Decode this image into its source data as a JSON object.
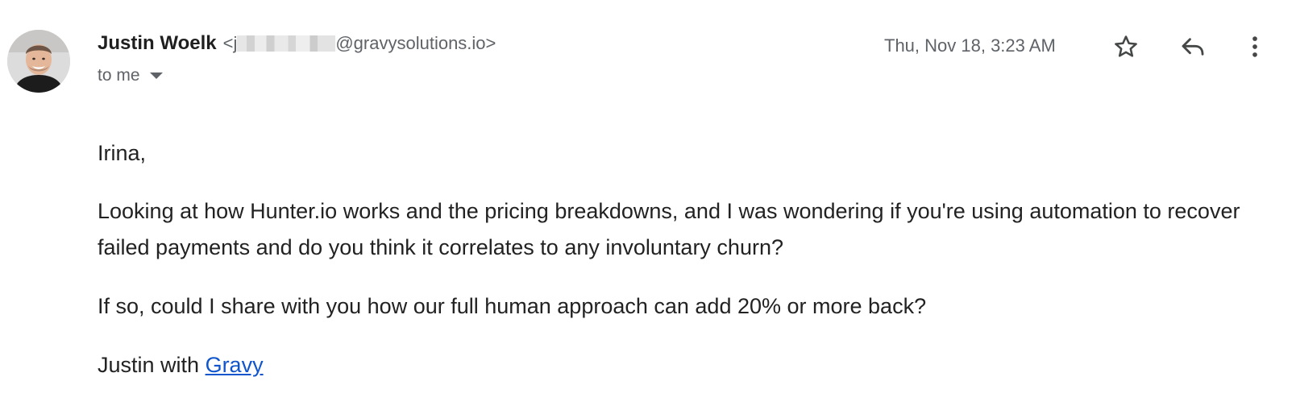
{
  "header": {
    "sender_name": "Justin Woelk",
    "email_prefix": "<j",
    "email_suffix": "@gravysolutions.io>",
    "recipient_label": "to me",
    "date": "Thu, Nov 18, 3:23 AM"
  },
  "icons": {
    "star": "star-outline-icon",
    "reply": "reply-icon",
    "more": "more-vert-icon"
  },
  "body": {
    "greeting": "Irina,",
    "paragraph_1": "Looking at how Hunter.io works and the pricing breakdowns, and I was wondering if you're using automation to recover failed payments and do you think it correlates to any involuntary churn?",
    "paragraph_2": "If so, could I share with you how our full human approach can add 20% or more back?",
    "signature_prefix": "Justin with ",
    "signature_link": "Gravy"
  },
  "colors": {
    "link": "#1155cc",
    "secondary_text": "#5f6368",
    "icon": "#444746"
  }
}
